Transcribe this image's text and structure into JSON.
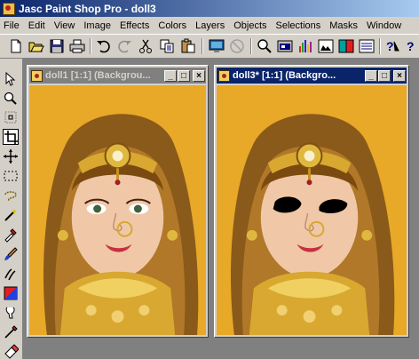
{
  "app": {
    "title": "Jasc Paint Shop Pro - doll3"
  },
  "menu": [
    "File",
    "Edit",
    "View",
    "Image",
    "Effects",
    "Colors",
    "Layers",
    "Objects",
    "Selections",
    "Masks",
    "Window"
  ],
  "toolbar_icons": [
    "new-icon",
    "open-icon",
    "save-icon",
    "print-icon",
    "undo-icon",
    "redo-icon",
    "cut-icon",
    "copy-icon",
    "paste-icon",
    "screen-capture-icon",
    "disabled-icon",
    "zoom-icon",
    "overview-icon",
    "histogram-icon",
    "color-palette-icon",
    "layer-palette-icon",
    "tool-options-icon",
    "help-icon",
    "context-help-icon"
  ],
  "tools": [
    "arrow-tool",
    "zoom-tool",
    "deformation-tool",
    "crop-tool",
    "mover-tool",
    "selection-tool",
    "freehand-tool",
    "dropper-tool",
    "paintbrush-tool",
    "clone-tool",
    "color-replacer-tool",
    "retouch-tool",
    "scratch-remover-tool",
    "eraser-tool"
  ],
  "windows": [
    {
      "title": "doll1 [1:1] (Backgrou...",
      "active": false
    },
    {
      "title": "doll3* [1:1] (Backgro...",
      "active": true
    }
  ],
  "window_buttons": {
    "minimize": "_",
    "maximize": "□",
    "close": "×"
  },
  "colors": {
    "titlebar": "#0a246a",
    "face": "#d4d0c8",
    "background": "#e8a828"
  }
}
